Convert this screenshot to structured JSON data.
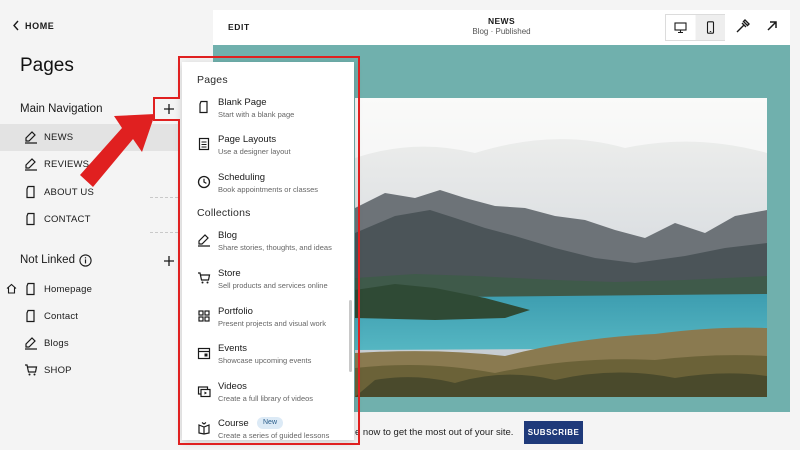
{
  "left_panel": {
    "home_label": "HOME",
    "heading": "Pages",
    "main_nav_title": "Main Navigation",
    "main_nav": [
      {
        "label": "NEWS",
        "icon": "blog-icon",
        "active": true
      },
      {
        "label": "REVIEWS",
        "icon": "blog-icon",
        "active": false
      },
      {
        "label": "ABOUT US",
        "icon": "page-icon",
        "active": false
      },
      {
        "label": "CONTACT",
        "icon": "page-icon",
        "active": false
      }
    ],
    "not_linked_title": "Not Linked",
    "not_linked": [
      {
        "label": "Homepage",
        "icon": "page-icon",
        "home": true
      },
      {
        "label": "Contact",
        "icon": "page-icon",
        "home": false
      },
      {
        "label": "Blogs",
        "icon": "blog-icon",
        "home": false
      },
      {
        "label": "SHOP",
        "icon": "cart-icon",
        "home": false
      }
    ]
  },
  "topbar": {
    "edit_label": "EDIT",
    "title": "NEWS",
    "subtitle": "Blog · Published",
    "device_buttons": [
      "desktop-icon",
      "mobile-icon"
    ],
    "tools": [
      "style-brush-icon",
      "open-external-icon"
    ]
  },
  "preview": {
    "background_color": "#70b0ad",
    "promo_text": "e now to get the most out of your site.",
    "subscribe_label": "SUBSCRIBE",
    "subscribe_color": "#1f3a7a"
  },
  "menu": {
    "pages_heading": "Pages",
    "collections_heading": "Collections",
    "pages": [
      {
        "title": "Blank Page",
        "desc": "Start with a blank page",
        "icon": "blank-page-icon"
      },
      {
        "title": "Page Layouts",
        "desc": "Use a designer layout",
        "icon": "layout-icon"
      },
      {
        "title": "Scheduling",
        "desc": "Book appointments or classes",
        "icon": "clock-icon"
      }
    ],
    "collections": [
      {
        "title": "Blog",
        "desc": "Share stories, thoughts, and ideas",
        "icon": "blog-icon"
      },
      {
        "title": "Store",
        "desc": "Sell products and services online",
        "icon": "cart-icon"
      },
      {
        "title": "Portfolio",
        "desc": "Present projects and visual work",
        "icon": "grid-icon"
      },
      {
        "title": "Events",
        "desc": "Showcase upcoming events",
        "icon": "calendar-icon"
      },
      {
        "title": "Videos",
        "desc": "Create a full library of videos",
        "icon": "video-icon"
      },
      {
        "title": "Course",
        "desc": "Create a series of guided lessons",
        "icon": "course-icon",
        "badge": "New"
      }
    ]
  },
  "annotation_color": "#e02020"
}
